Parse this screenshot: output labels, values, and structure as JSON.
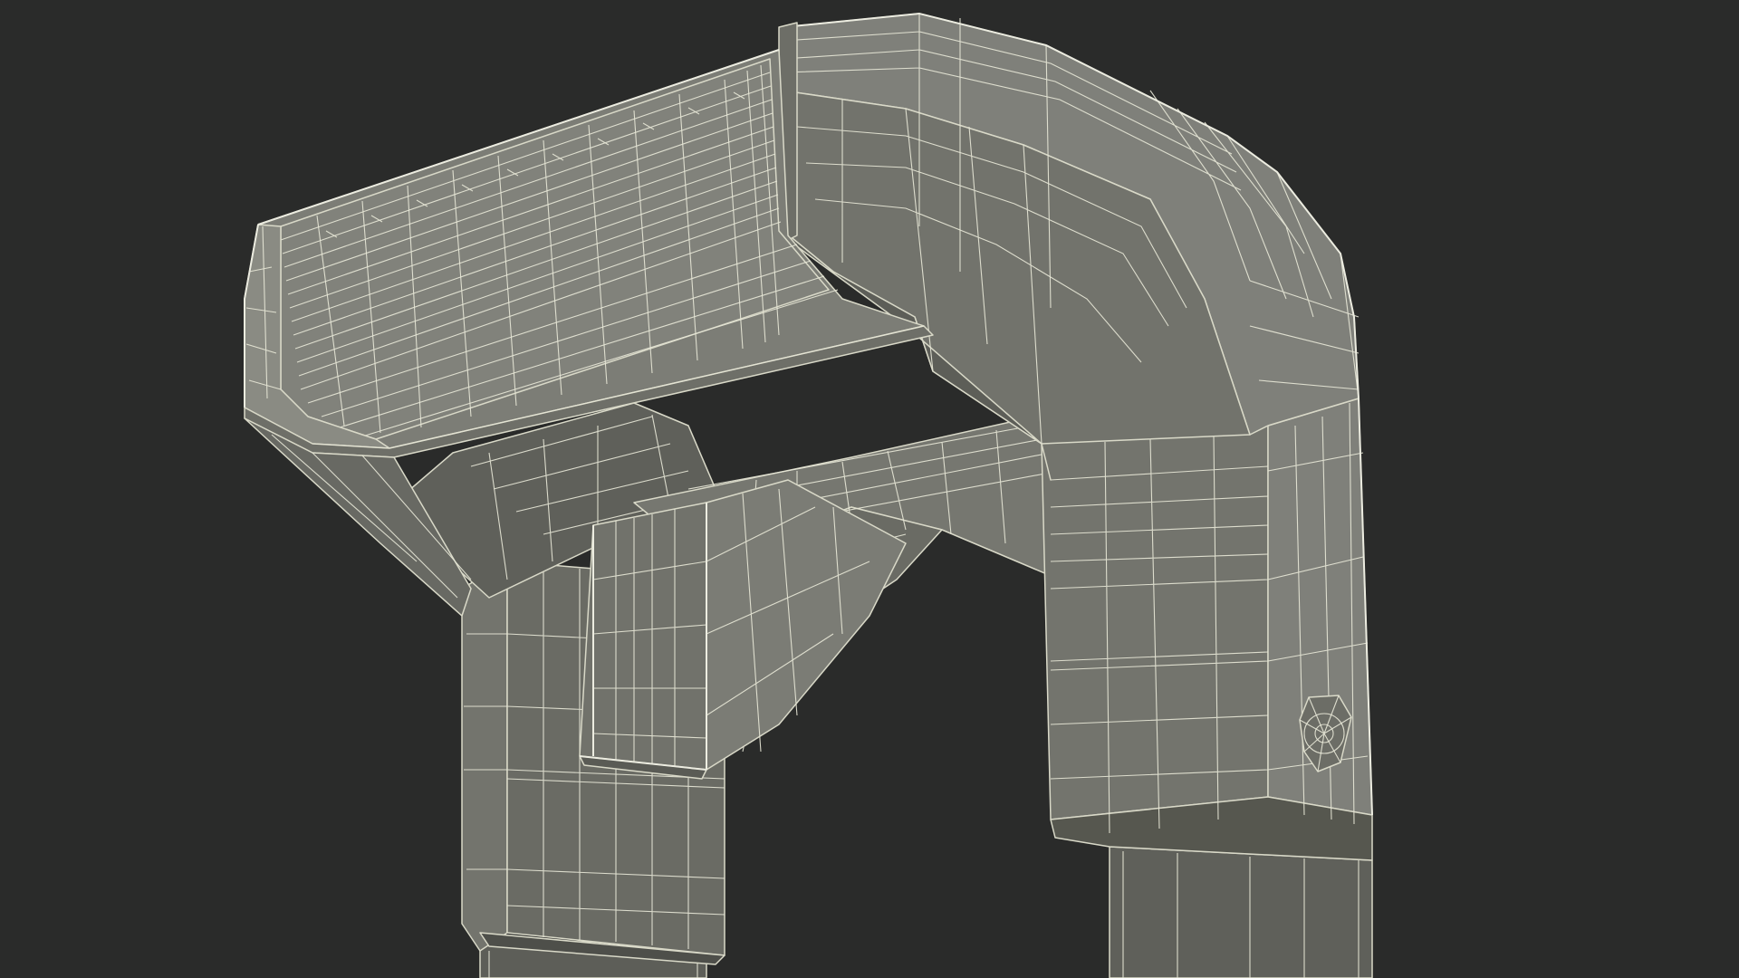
{
  "scene": {
    "subject": "wireframe-3d-model",
    "colors": {
      "background": "#2a2b2a",
      "surface_light": "#80817a",
      "surface_mid": "#73746d",
      "surface_dark": "#5d5e58",
      "surface_shadow": "#4e4f4a",
      "wire": "#e6e6d6"
    }
  }
}
